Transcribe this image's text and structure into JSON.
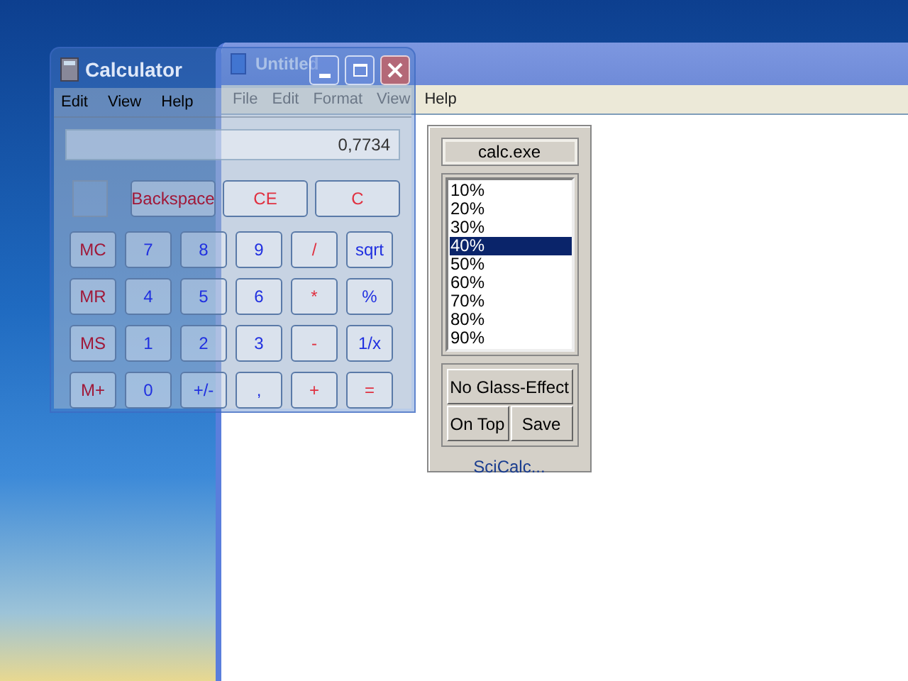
{
  "notepad": {
    "title": "Untitled",
    "menu": [
      "File",
      "Edit",
      "Format",
      "View",
      "Help"
    ]
  },
  "calculator": {
    "title": "Calculator",
    "menu": [
      "Edit",
      "View",
      "Help"
    ],
    "display": "0,7734",
    "top_keys": [
      {
        "label": "Backspace",
        "kind": "memory"
      },
      {
        "label": "CE",
        "kind": "operator"
      },
      {
        "label": "C",
        "kind": "operator"
      }
    ],
    "keys": [
      {
        "label": "MC",
        "kind": "memory"
      },
      {
        "label": "7",
        "kind": "digit"
      },
      {
        "label": "8",
        "kind": "digit"
      },
      {
        "label": "9",
        "kind": "digit"
      },
      {
        "label": "/",
        "kind": "operator"
      },
      {
        "label": "sqrt",
        "kind": "digit"
      },
      {
        "label": "MR",
        "kind": "memory"
      },
      {
        "label": "4",
        "kind": "digit"
      },
      {
        "label": "5",
        "kind": "digit"
      },
      {
        "label": "6",
        "kind": "digit"
      },
      {
        "label": "*",
        "kind": "operator"
      },
      {
        "label": "%",
        "kind": "digit"
      },
      {
        "label": "MS",
        "kind": "memory"
      },
      {
        "label": "1",
        "kind": "digit"
      },
      {
        "label": "2",
        "kind": "digit"
      },
      {
        "label": "3",
        "kind": "digit"
      },
      {
        "label": "-",
        "kind": "operator"
      },
      {
        "label": "1/x",
        "kind": "digit"
      },
      {
        "label": "M+",
        "kind": "memory"
      },
      {
        "label": "0",
        "kind": "digit"
      },
      {
        "label": "+/-",
        "kind": "digit"
      },
      {
        "label": ",",
        "kind": "digit"
      },
      {
        "label": "+",
        "kind": "operator"
      },
      {
        "label": "=",
        "kind": "operator"
      }
    ]
  },
  "glass_panel": {
    "process": "calc.exe",
    "levels": [
      {
        "label": "10%",
        "selected": false
      },
      {
        "label": "20%",
        "selected": false
      },
      {
        "label": "30%",
        "selected": false
      },
      {
        "label": "40%",
        "selected": true
      },
      {
        "label": "50%",
        "selected": false
      },
      {
        "label": "60%",
        "selected": false
      },
      {
        "label": "70%",
        "selected": false
      },
      {
        "label": "80%",
        "selected": false
      },
      {
        "label": "90%",
        "selected": false
      }
    ],
    "wide_button": "No Glass-Effect",
    "buttons": [
      "On Top",
      "Save"
    ],
    "link": "SciCalc..."
  }
}
